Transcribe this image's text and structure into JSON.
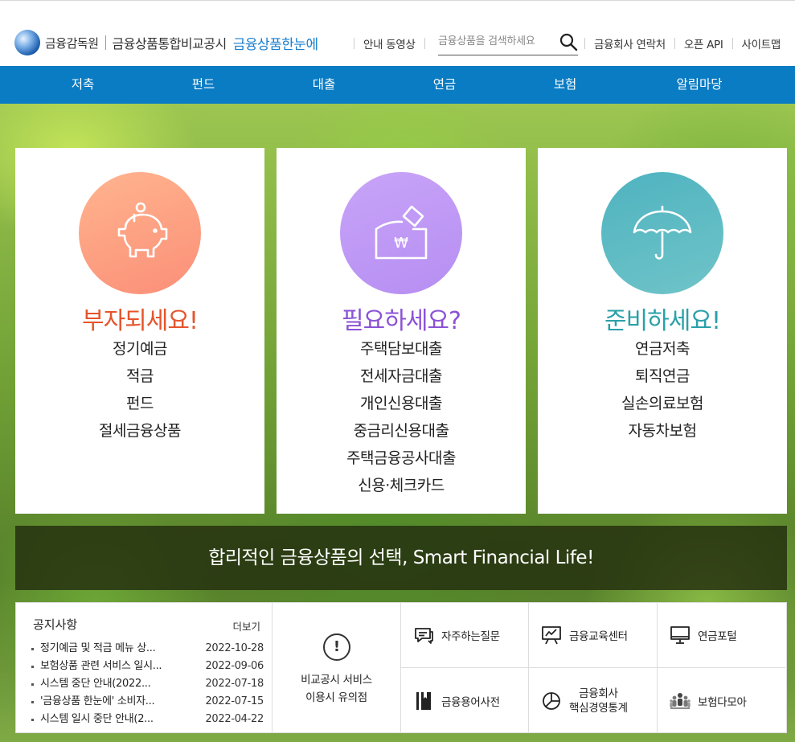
{
  "header": {
    "org_name": "금융감독원",
    "site_name": "금융상품통합비교공시",
    "brand_name": "금융상품한눈에",
    "util_video": "안내 동영상",
    "search_placeholder": "금융상품을 검색하세요",
    "util_contacts": "금융회사 연락처",
    "util_api": "오픈 API",
    "util_sitemap": "사이트맵"
  },
  "nav": [
    "저축",
    "펀드",
    "대출",
    "연금",
    "보험",
    "알림마당"
  ],
  "cards": [
    {
      "title": "부자되세요!",
      "color": "#e5552b",
      "items": [
        "정기예금",
        "적금",
        "펀드",
        "절세금융상품"
      ]
    },
    {
      "title": "필요하세요?",
      "color": "#8b52d6",
      "items": [
        "주택담보대출",
        "전세자금대출",
        "개인신용대출",
        "중금리신용대출",
        "주택금융공사대출",
        "신용·체크카드"
      ]
    },
    {
      "title": "준비하세요!",
      "color": "#2aa0a8",
      "items": [
        "연금저축",
        "퇴직연금",
        "실손의료보험",
        "자동차보험"
      ]
    }
  ],
  "slogan": "합리적인 금융상품의 선택, Smart Financial Life!",
  "notice": {
    "title": "공지사항",
    "more": "더보기",
    "items": [
      {
        "text": "정기예금 및 적금 메뉴 상...",
        "date": "2022-10-28"
      },
      {
        "text": "보험상품 관련 서비스 일시...",
        "date": "2022-09-06"
      },
      {
        "text": "시스템 중단 안내(2022...",
        "date": "2022-07-18"
      },
      {
        "text": "'금융상품 한눈에' 소비자...",
        "date": "2022-07-15"
      },
      {
        "text": "시스템 일시 중단 안내(2...",
        "date": "2022-04-22"
      }
    ]
  },
  "caution": {
    "line1": "비교공시 서비스",
    "line2": "이용시 유의점"
  },
  "quick_links": [
    {
      "label": "자주하는질문",
      "icon": "chat-icon"
    },
    {
      "label": "금융교육센터",
      "icon": "presentation-icon"
    },
    {
      "label": "연금포털",
      "icon": "monitor-icon"
    },
    {
      "label": "금융용어사전",
      "icon": "book-icon"
    },
    {
      "label": "금융회사\n핵심경영통계",
      "icon": "pie-chart-icon"
    },
    {
      "label": "보험다모아",
      "icon": "people-icon"
    }
  ]
}
